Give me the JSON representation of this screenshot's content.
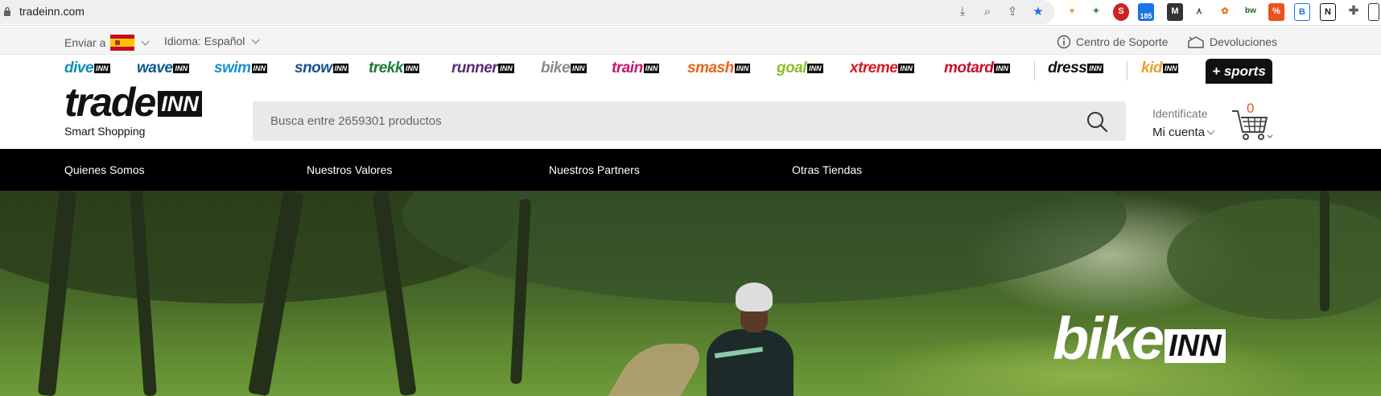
{
  "browser": {
    "url": "tradeinn.com",
    "omnibox_icons": [
      "download-icon",
      "zoom-icon",
      "share-icon",
      "bookmark-star-icon"
    ],
    "extension_badge": "185"
  },
  "util": {
    "ship_to_label": "Enviar a",
    "language_label": "Idioma: Español",
    "support_label": "Centro de Soporte",
    "returns_label": "Devoluciones"
  },
  "brands": [
    {
      "name": "dive",
      "color": "#0a8fb0"
    },
    {
      "name": "wave",
      "color": "#0b5a8a"
    },
    {
      "name": "swim",
      "color": "#1d8fcf"
    },
    {
      "name": "snow",
      "color": "#1a4f8c"
    },
    {
      "name": "trekk",
      "color": "#1f7a3a"
    },
    {
      "name": "runner",
      "color": "#5b2a7a"
    },
    {
      "name": "bike",
      "color": "#8a8a8a"
    },
    {
      "name": "train",
      "color": "#c8156e"
    },
    {
      "name": "smash",
      "color": "#e8631c"
    },
    {
      "name": "goal",
      "color": "#8cbf2a"
    },
    {
      "name": "xtreme",
      "color": "#d9191f"
    },
    {
      "name": "motard",
      "color": "#c8102e"
    },
    {
      "name": "dress",
      "color": "#111111"
    },
    {
      "name": "kid",
      "color": "#e8a02a"
    }
  ],
  "brand_suffix": "INN",
  "more_sports_label": "+ sports",
  "header": {
    "logo_main": "trade",
    "logo_suffix": "INN",
    "tagline": "Smart Shopping",
    "search_placeholder": "Busca entre 2659301 productos",
    "login_label": "Identifícate",
    "account_label": "Mi cuenta",
    "cart_count": "0"
  },
  "nav": {
    "items": [
      "Quienes Somos",
      "Nuestros Valores",
      "Nuestros Partners",
      "Otras Tiendas"
    ]
  },
  "hero": {
    "brand_main": "bike",
    "brand_suffix": "INN"
  },
  "colors": {
    "accent": "#e8531e",
    "nav_bg": "#000000"
  }
}
